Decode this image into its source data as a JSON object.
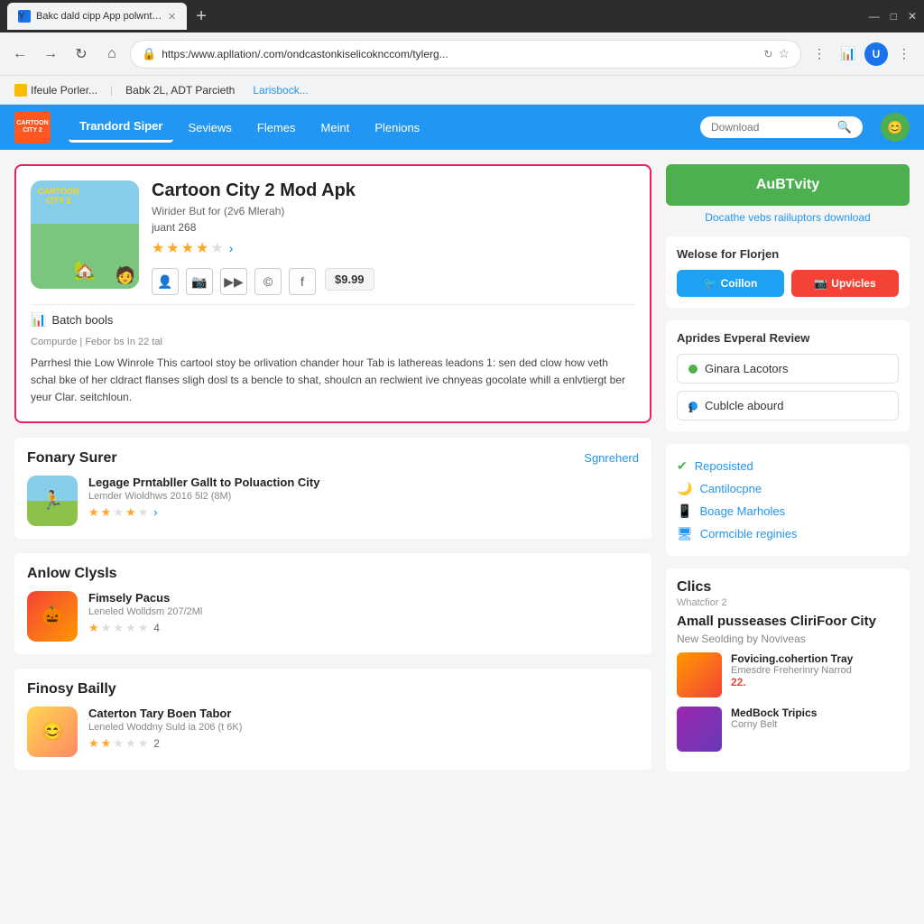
{
  "browser": {
    "tab_title": "Bakc dald cipp App polwntoak.",
    "tab_favicon": "Y",
    "url": "https:/www.apllation/.com/ondcastonkiselicoknccom/tylerg...",
    "new_tab_label": "+",
    "window_controls": [
      "—",
      "□",
      "✕"
    ],
    "bookmarks": [
      {
        "label": "Ifeule Porler...",
        "icon": "bookmark-icon"
      },
      {
        "label": "Babk 2L, ADT Parcieth",
        "icon": "bookmark-icon"
      },
      {
        "label": "Larisbock...",
        "icon": "bookmark-icon",
        "colored": true
      }
    ]
  },
  "site": {
    "logo_text": "CARTOON\nCITY 2",
    "nav_items": [
      {
        "label": "Trandord Siper",
        "active": true
      },
      {
        "label": "Seviews"
      },
      {
        "label": "Flemes"
      },
      {
        "label": "Meint"
      },
      {
        "label": "Plenions"
      }
    ],
    "search_placeholder": "Download"
  },
  "app": {
    "title": "Cartoon City 2 Mod Apk",
    "subtitle": "Wirider But for (2v6 Mlerah)",
    "count": "juant 268",
    "rating": 3.5,
    "price": "$9.99",
    "tools_label": "Batch bools",
    "meta": "Compurde  |  Febor bs In 22 tal",
    "description": "Parrhesl thie Low Winrole This cartool stoy be orlivation chander hour Tab is lathereas leadons  1: sen ded clow how veth schal bke of her cldract flanses sligh dosl ts a bencle to shat, shoulcn an reclwient ive chnyeas gocolate whill a enlvtiergt ber yeur Clar. seitchloun.",
    "action_icons": [
      "👤",
      "📷",
      "▶▶",
      "©",
      "f"
    ]
  },
  "sections": {
    "section1": {
      "title": "Fonary Surer",
      "link": "Sgnreherd",
      "app": {
        "title": "Legage Prntabller Gallt to Poluaction City",
        "sub": "Lemder Wioldhws 2016 5l2 (8M)",
        "rating": 2.5
      }
    },
    "section2": {
      "title": "Anlow Clysls",
      "app": {
        "title": "Fimsely Pacus",
        "sub": "Leneled Wolldsm 207/2Ml",
        "rating": 1,
        "count": "4"
      }
    },
    "section3": {
      "title": "Finosy Bailly",
      "app": {
        "title": "Caterton Tary Boen Tabor",
        "sub": "Leneled Woddny Suld ia 206 (t 6K)",
        "rating": 2,
        "count": "2"
      }
    }
  },
  "sidebar": {
    "download_btn": "AuBTvity",
    "download_link": "Docathe vebs raiiluptors download",
    "welcome": "Welose for Florjen",
    "social": {
      "twitter_label": "Coillon",
      "upload_label": "Upvicles"
    },
    "reviews_title": "Aprides Evperal Review",
    "review_btn1": "Ginara Lacotors",
    "review_btn2": "Cublcle abourd",
    "checks": [
      {
        "icon": "check",
        "label": "Reposisted"
      },
      {
        "icon": "moon",
        "label": "Cantilocpne"
      },
      {
        "icon": "tablet",
        "label": "Boage Marholes"
      },
      {
        "icon": "monitor",
        "label": "Cormcible reginies"
      }
    ],
    "clics_section": "Clics",
    "clics_sub": "Whatcfior 2",
    "clics_title": "Amall pusseases CliriFoor City",
    "clics_author": "New Seolding by Noviveas",
    "clics_item1_title": "Fovicing.cohertion Tray",
    "clics_item1_sub": "Emesdre Freherinry Narrod",
    "clics_item1_num": "22.",
    "clics_item2_title": "MedBock Tripics",
    "clics_item2_sub": "Corny Belt"
  }
}
